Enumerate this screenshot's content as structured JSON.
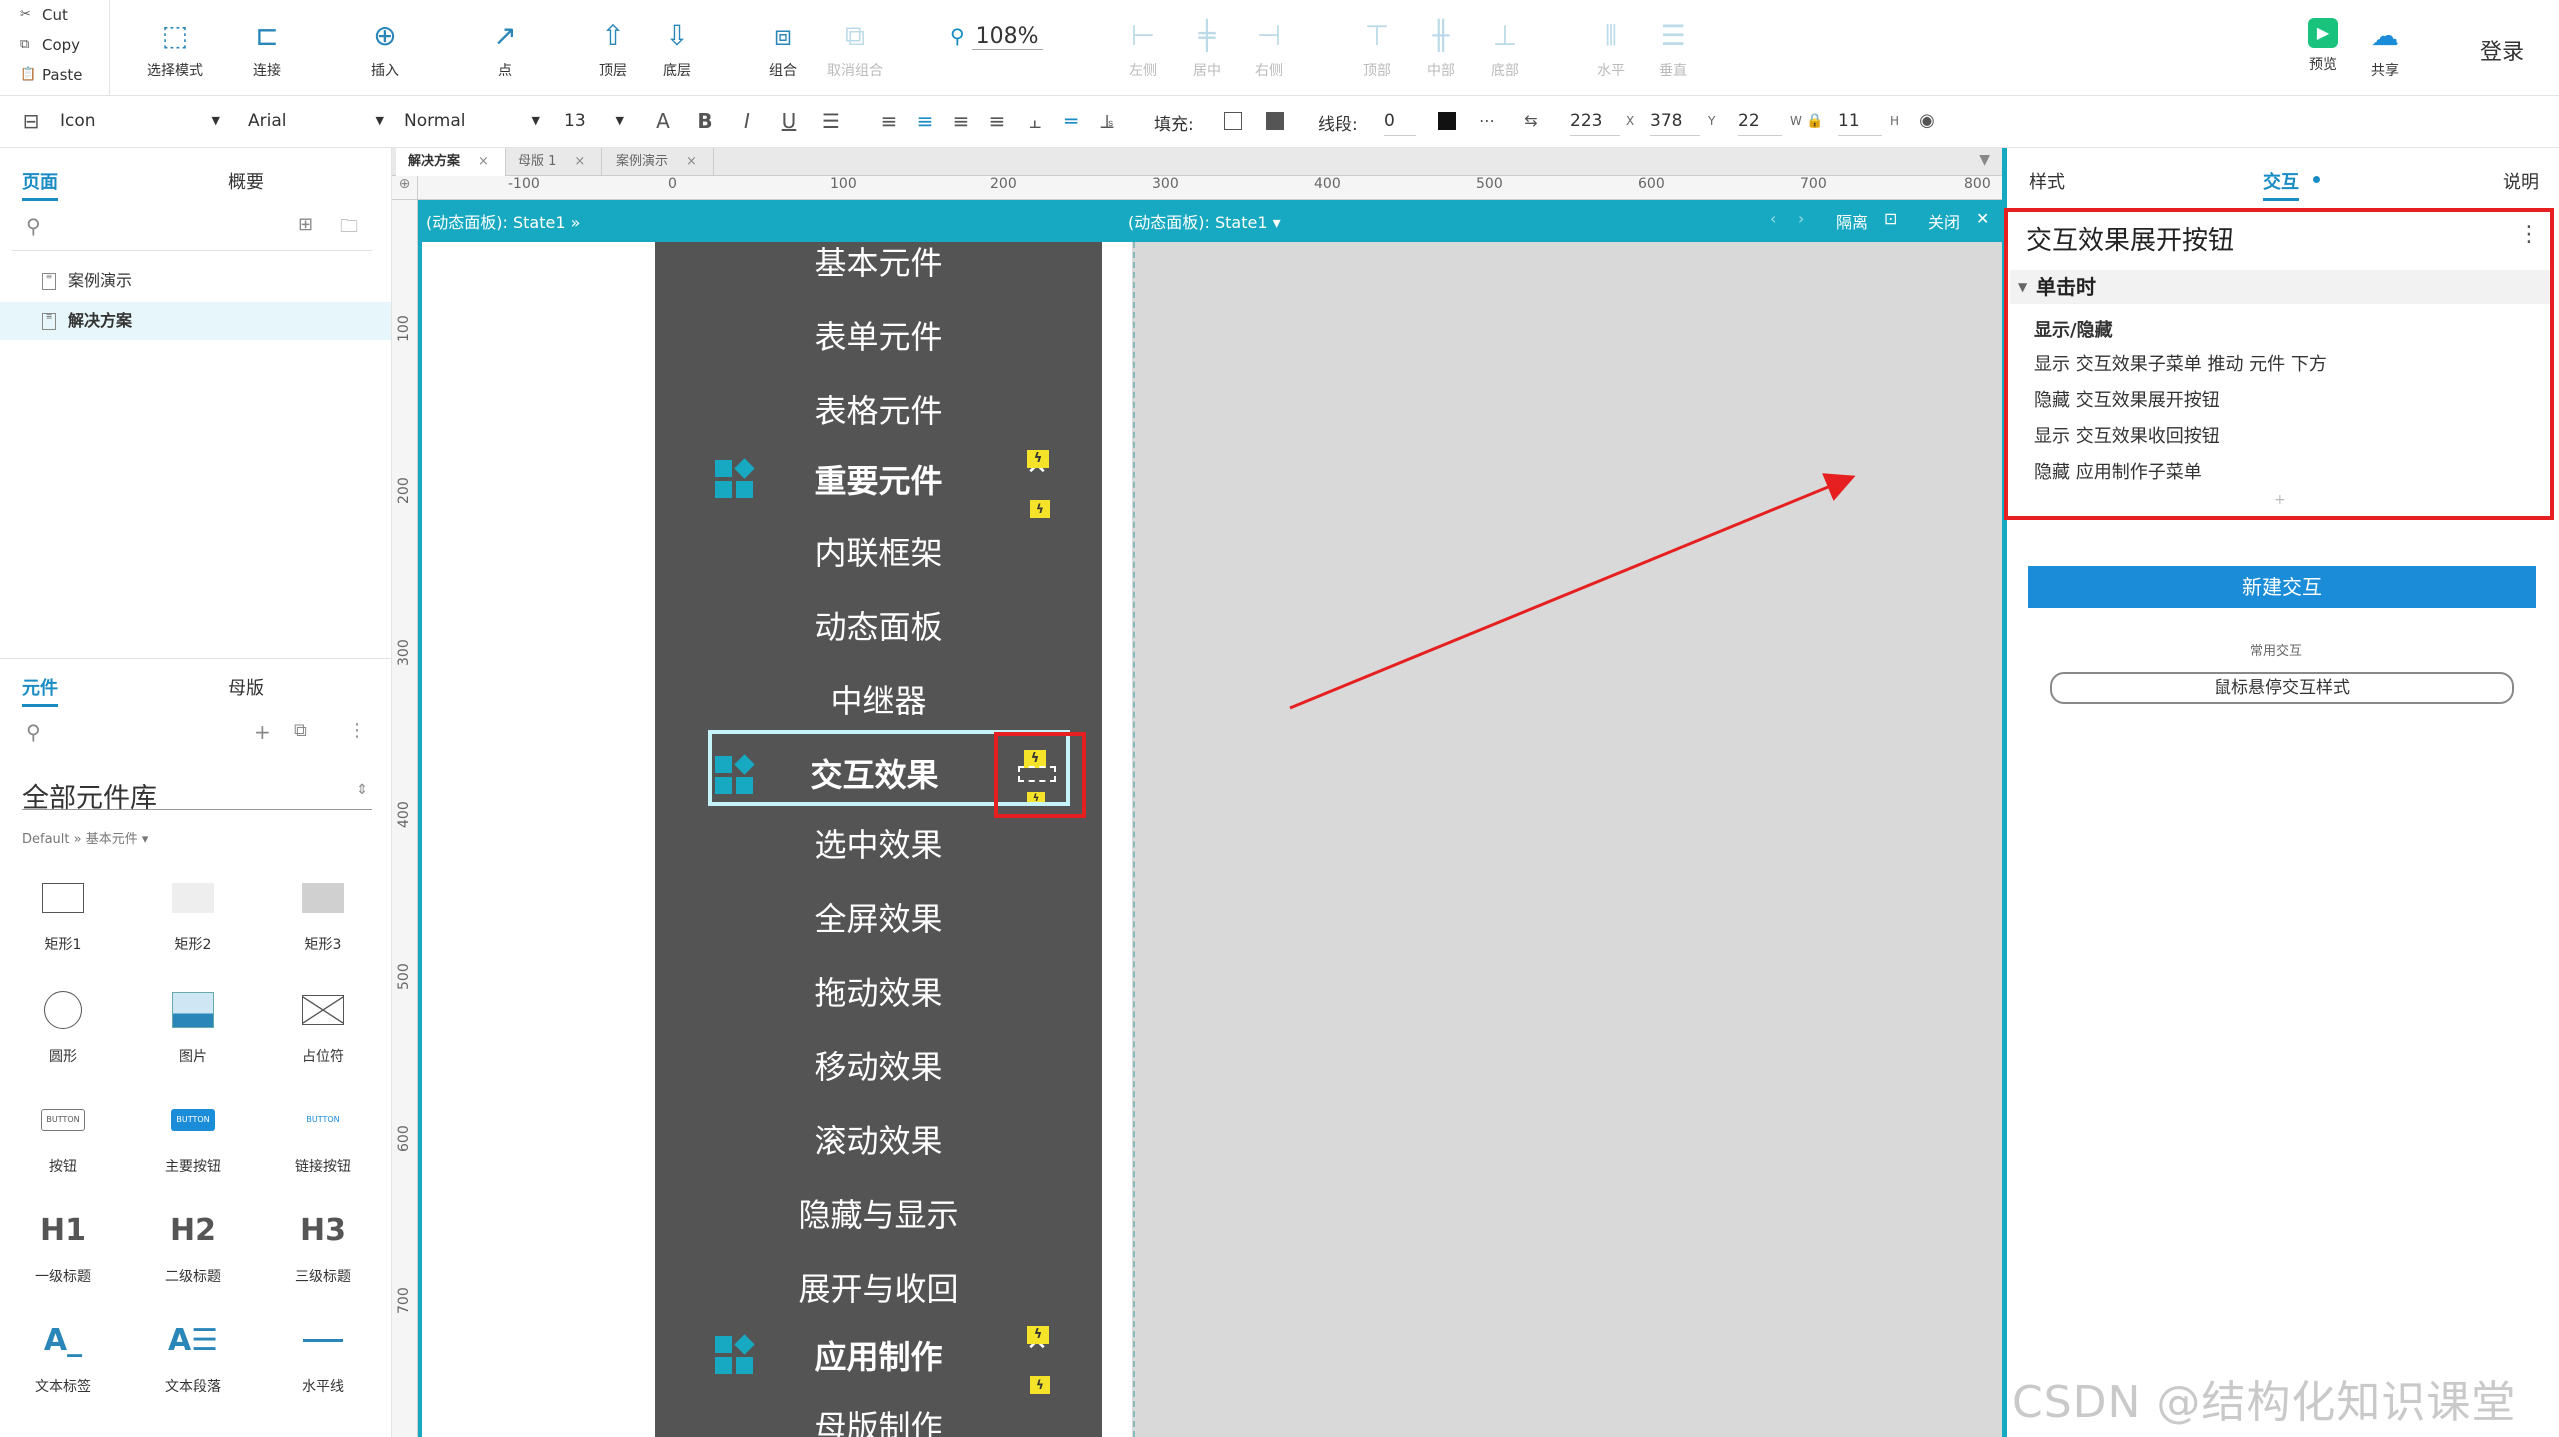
{
  "clipboard": {
    "cut": "Cut",
    "copy": "Copy",
    "paste": "Paste"
  },
  "toolbar": {
    "select_mode": "选择模式",
    "connect": "连接",
    "insert": "插入",
    "point": "点",
    "top_layer": "顶层",
    "bottom_layer": "底层",
    "group": "组合",
    "ungroup": "取消组合",
    "zoom": "108%",
    "align_left": "左侧",
    "align_center": "居中",
    "align_right": "右侧",
    "align_top": "顶部",
    "align_middle": "中部",
    "align_bottom": "底部",
    "dist_h": "水平",
    "dist_v": "垂直",
    "preview": "预览",
    "share": "共享",
    "login": "登录"
  },
  "format": {
    "style": "Icon",
    "font": "Arial",
    "weight": "Normal",
    "size": "13",
    "fill_label": "填充:",
    "stroke_label": "线段:",
    "stroke_value": "0",
    "x": "223",
    "x_unit": "X",
    "y": "378",
    "y_unit": "Y",
    "w": "22",
    "w_unit": "W",
    "h": "11",
    "h_unit": "H"
  },
  "left_panel": {
    "tabs": [
      "页面",
      "概要"
    ],
    "pages": [
      "案例演示",
      "解决方案"
    ],
    "lib_tabs": [
      "元件",
      "母版"
    ],
    "library": "全部元件库",
    "lib_path": "Default » 基本元件 ▾",
    "widgets": [
      "矩形1",
      "矩形2",
      "矩形3",
      "圆形",
      "图片",
      "占位符",
      "按钮",
      "主要按钮",
      "链接按钮",
      "一级标题",
      "二级标题",
      "三级标题",
      "文本标签",
      "文本段落",
      "水平线"
    ],
    "widget_thumbs": {
      "button": "BUTTON",
      "h1": "H1",
      "h2": "H2",
      "h3": "H3"
    }
  },
  "doc_tabs": [
    "解决方案",
    "母版 1",
    "案例演示"
  ],
  "ruler_h": [
    "-100",
    "0",
    "100",
    "200",
    "300",
    "400",
    "500",
    "600",
    "700",
    "800"
  ],
  "ruler_v": [
    "100",
    "200",
    "300",
    "400",
    "500",
    "600",
    "700"
  ],
  "dp_bar": {
    "left": "(动态面板): State1 »",
    "center": "(动态面板): State1 ▾",
    "isolate": "隔离",
    "close": "关闭"
  },
  "menu_items": [
    "基本元件",
    "表单元件",
    "表格元件",
    "重要元件",
    "内联框架",
    "动态面板",
    "中继器",
    "交互效果",
    "选中效果",
    "全屏效果",
    "拖动效果",
    "移动效果",
    "滚动效果",
    "隐藏与显示",
    "展开与收回",
    "应用制作",
    "母版制作"
  ],
  "right_panel": {
    "tabs": [
      "样式",
      "交互",
      "说明"
    ],
    "widget_name": "交互效果展开按钮",
    "event": "单击时",
    "action_head": "显示/隐藏",
    "actions": [
      "显示 交互效果子菜单 推动 元件 下方",
      "隐藏 交互效果展开按钮",
      "显示 交互效果收回按钮",
      "隐藏 应用制作子菜单"
    ],
    "new_interaction": "新建交互",
    "common_label": "常用交互",
    "hover_style": "鼠标悬停交互样式"
  },
  "watermark": "CSDN @结构化知识课堂",
  "colors": {
    "accent": "#17a9c1",
    "primary": "#1a8cd8",
    "highlight": "#e62020",
    "menu_bg": "#545454"
  }
}
